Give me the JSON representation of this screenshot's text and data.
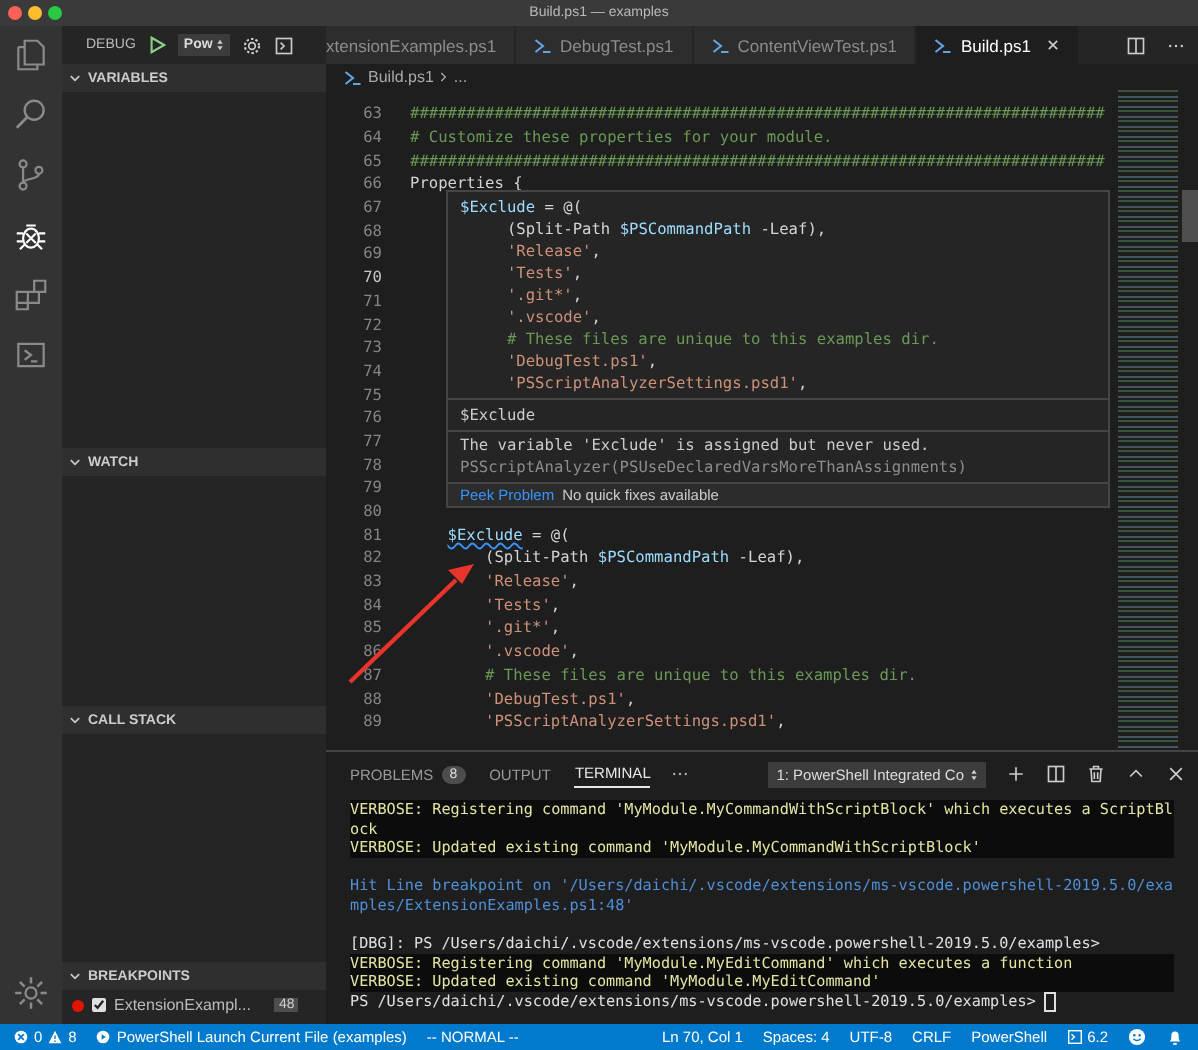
{
  "window": {
    "title": "Build.ps1 — examples"
  },
  "activity_bar": [
    {
      "kind": "files",
      "selected": false
    },
    {
      "kind": "search",
      "selected": false
    },
    {
      "kind": "branch",
      "selected": false
    },
    {
      "kind": "bug",
      "selected": true
    },
    {
      "kind": "extensions",
      "selected": false
    },
    {
      "kind": "terminal",
      "selected": false
    }
  ],
  "debug_toolbar": {
    "label": "DEBUG",
    "configuration": "Pow"
  },
  "sidebar": {
    "sections": [
      {
        "title": "VARIABLES",
        "expanded": true
      },
      {
        "title": "WATCH",
        "expanded": true
      },
      {
        "title": "CALL STACK",
        "expanded": true
      },
      {
        "title": "BREAKPOINTS",
        "expanded": true
      }
    ],
    "breakpoints": [
      {
        "file": "ExtensionExampl...",
        "line": "48",
        "checked": true
      }
    ]
  },
  "tabs": [
    {
      "label": "xtensionExamples.ps1",
      "icon": false,
      "selected": false
    },
    {
      "label": "DebugTest.ps1",
      "icon": true,
      "selected": false
    },
    {
      "label": "ContentViewTest.ps1",
      "icon": true,
      "selected": false
    },
    {
      "label": "Build.ps1",
      "icon": true,
      "selected": true
    }
  ],
  "breadcrumb": [
    "Build.ps1",
    "..."
  ],
  "editor": {
    "lines": [
      {
        "number": "63",
        "current": false,
        "tokens": [
          {
            "kind": "comment",
            "text": "##########################################################################"
          }
        ]
      },
      {
        "number": "64",
        "current": false,
        "tokens": [
          {
            "kind": "comment",
            "text": "# Customize these properties for your module."
          }
        ]
      },
      {
        "number": "65",
        "current": false,
        "tokens": [
          {
            "kind": "comment",
            "text": "##########################################################################"
          }
        ]
      },
      {
        "number": "66",
        "current": false,
        "tokens": [
          {
            "kind": "plain",
            "text": "Properties {"
          }
        ]
      },
      {
        "number": "67",
        "current": false
      },
      {
        "number": "68",
        "current": false
      },
      {
        "number": "69",
        "current": false
      },
      {
        "number": "70",
        "current": true
      },
      {
        "number": "71",
        "current": false
      },
      {
        "number": "72",
        "current": false
      },
      {
        "number": "73",
        "current": false
      },
      {
        "number": "74",
        "current": false
      },
      {
        "number": "75",
        "current": false
      },
      {
        "number": "76",
        "current": false
      },
      {
        "number": "77",
        "current": false
      },
      {
        "number": "78",
        "current": false
      },
      {
        "number": "79",
        "current": false
      },
      {
        "number": "80",
        "current": false
      },
      {
        "number": "81",
        "current": false,
        "kind": "nested",
        "tokens": [
          {
            "kind": "flagged",
            "text": "$Exclude"
          },
          {
            "kind": "plain",
            "text": " = @("
          }
        ]
      },
      {
        "number": "82",
        "current": false,
        "kind": "item",
        "tokens": [
          {
            "kind": "plain",
            "text": "(Split-Path "
          },
          {
            "kind": "var",
            "text": "$PSCommandPath"
          },
          {
            "kind": "plain",
            "text": " -Leaf),"
          }
        ]
      },
      {
        "number": "83",
        "current": false,
        "kind": "item",
        "tokens": [
          {
            "kind": "string",
            "text": "'Release'"
          },
          {
            "kind": "plain",
            "text": ","
          }
        ]
      },
      {
        "number": "84",
        "current": false,
        "kind": "item",
        "tokens": [
          {
            "kind": "string",
            "text": "'Tests'"
          },
          {
            "kind": "plain",
            "text": ","
          }
        ]
      },
      {
        "number": "85",
        "current": false,
        "kind": "item",
        "tokens": [
          {
            "kind": "string",
            "text": "'.git*'"
          },
          {
            "kind": "plain",
            "text": ","
          }
        ]
      },
      {
        "number": "86",
        "current": false,
        "kind": "item",
        "tokens": [
          {
            "kind": "string",
            "text": "'.vscode'"
          },
          {
            "kind": "plain",
            "text": ","
          }
        ]
      },
      {
        "number": "87",
        "current": false,
        "kind": "item",
        "tokens": [
          {
            "kind": "comment",
            "text": "# These files are unique to this examples dir."
          }
        ]
      },
      {
        "number": "88",
        "current": false,
        "kind": "item",
        "tokens": [
          {
            "kind": "string",
            "text": "'DebugTest.ps1'"
          },
          {
            "kind": "plain",
            "text": ","
          }
        ]
      },
      {
        "number": "89",
        "current": false,
        "kind": "item",
        "tokens": [
          {
            "kind": "string",
            "text": "'PSScriptAnalyzerSettings.psd1'"
          },
          {
            "kind": "plain",
            "text": ","
          }
        ]
      }
    ]
  },
  "hover": {
    "code": [
      {
        "kind": "top",
        "tokens": [
          {
            "kind": "var",
            "text": "$Exclude"
          },
          {
            "kind": "plain",
            "text": " = @("
          }
        ]
      },
      {
        "kind": "nested",
        "tokens": [
          {
            "kind": "plain",
            "text": "(Split-Path "
          },
          {
            "kind": "var",
            "text": "$PSCommandPath"
          },
          {
            "kind": "plain",
            "text": " -Leaf),"
          }
        ]
      },
      {
        "kind": "nested",
        "tokens": [
          {
            "kind": "string",
            "text": "'Release'"
          },
          {
            "kind": "plain",
            "text": ","
          }
        ]
      },
      {
        "kind": "nested",
        "tokens": [
          {
            "kind": "string",
            "text": "'Tests'"
          },
          {
            "kind": "plain",
            "text": ","
          }
        ]
      },
      {
        "kind": "nested",
        "tokens": [
          {
            "kind": "string",
            "text": "'.git*'"
          },
          {
            "kind": "plain",
            "text": ","
          }
        ]
      },
      {
        "kind": "nested",
        "tokens": [
          {
            "kind": "string",
            "text": "'.vscode'"
          },
          {
            "kind": "plain",
            "text": ","
          }
        ]
      },
      {
        "kind": "nested",
        "tokens": [
          {
            "kind": "comment",
            "text": "# These files are unique to this examples dir."
          }
        ]
      },
      {
        "kind": "nested",
        "tokens": [
          {
            "kind": "string",
            "text": "'DebugTest.ps1'"
          },
          {
            "kind": "plain",
            "text": ","
          }
        ]
      },
      {
        "kind": "nested",
        "tokens": [
          {
            "kind": "string",
            "text": "'PSScriptAnalyzerSettings.psd1'"
          },
          {
            "kind": "plain",
            "text": ","
          }
        ]
      }
    ],
    "symbol": "$Exclude",
    "message": "The variable 'Exclude' is assigned but never used.",
    "source": "PSScriptAnalyzer(PSUseDeclaredVarsMoreThanAssignments)",
    "action": "Peek Problem",
    "note": "No quick fixes available"
  },
  "panel": {
    "tabs": [
      {
        "label": "PROBLEMS",
        "badge": "8",
        "selected": false
      },
      {
        "label": "OUTPUT",
        "selected": false
      },
      {
        "label": "TERMINAL",
        "selected": true
      }
    ],
    "terminal_selector": "1: PowerShell Integrated Co",
    "lines": [
      {
        "kind": "verbose",
        "text": "VERBOSE: Registering command 'MyModule.MyCommandWithScriptBlock' which executes a ScriptBl"
      },
      {
        "kind": "verbose",
        "text": "ock"
      },
      {
        "kind": "verbose",
        "text": "VERBOSE: Updated existing command 'MyModule.MyCommandWithScriptBlock'"
      },
      {
        "kind": "blank"
      },
      {
        "kind": "info",
        "text": "Hit Line breakpoint on '/Users/daichi/.vscode/extensions/ms-vscode.powershell-2019.5.0/exa"
      },
      {
        "kind": "info",
        "text": "mples/ExtensionExamples.ps1:48'"
      },
      {
        "kind": "blank"
      },
      {
        "kind": "output",
        "text": "[DBG]: PS /Users/daichi/.vscode/extensions/ms-vscode.powershell-2019.5.0/examples>"
      },
      {
        "kind": "verbose",
        "text": "VERBOSE: Registering command 'MyModule.MyEditCommand' which executes a function"
      },
      {
        "kind": "verbose",
        "text": "VERBOSE: Updated existing command 'MyModule.MyEditCommand'"
      },
      {
        "kind": "prompt",
        "text": "PS /Users/daichi/.vscode/extensions/ms-vscode.powershell-2019.5.0/examples>"
      }
    ]
  },
  "status_bar": {
    "errors": "0",
    "warnings": "8",
    "launch": "PowerShell Launch Current File (examples)",
    "mode": "-- NORMAL --",
    "items": [
      "Ln 70, Col 1",
      "Spaces: 4",
      "UTF-8",
      "CRLF",
      "PowerShell"
    ],
    "version": "6.2"
  }
}
